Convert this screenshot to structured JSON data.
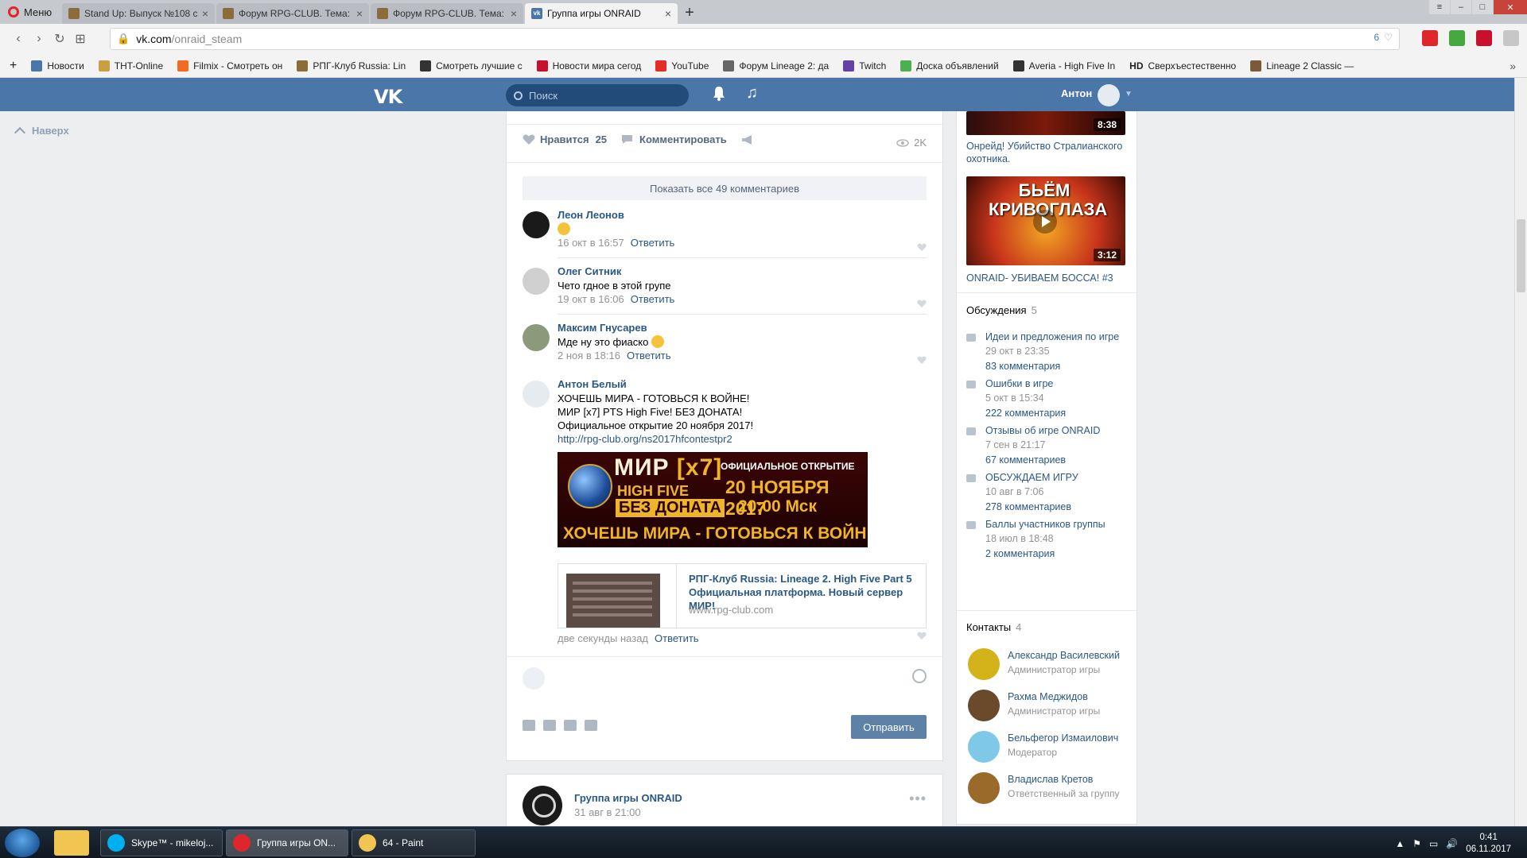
{
  "browser": {
    "menu_label": "Меню",
    "tabs": [
      {
        "title": "Stand Up: Выпуск №108 с",
        "active": false
      },
      {
        "title": "Форум RPG-CLUB. Тема: Ц",
        "active": false
      },
      {
        "title": "Форум RPG-CLUB. Тема: Ц",
        "active": false
      },
      {
        "title": "Группа игры ONRAID",
        "active": true
      }
    ],
    "url_host": "vk.com",
    "url_path": "/onraid_steam",
    "url_badge": "6",
    "bookmarks": [
      {
        "label": "Новости",
        "color": "#4a76a8"
      },
      {
        "label": "THT-Online",
        "color": "#c8a040"
      },
      {
        "label": "Filmix - Смотреть он",
        "color": "#f26b22"
      },
      {
        "label": "РПГ-Клуб Russia: Lin",
        "color": "#8a6d3b"
      },
      {
        "label": "Смотреть лучшие с",
        "color": "#333333"
      },
      {
        "label": "Новости мира сегод",
        "color": "#c8102e"
      },
      {
        "label": "YouTube",
        "color": "#e52d27"
      },
      {
        "label": "Форум Lineage 2: да",
        "color": "#666666"
      },
      {
        "label": "Twitch",
        "color": "#6441a4"
      },
      {
        "label": "Доска объявлений",
        "color": "#4caf50"
      },
      {
        "label": "Averia - High Five In",
        "color": "#333333"
      },
      {
        "label": "Сверхъестественно",
        "color": "#222222"
      },
      {
        "label": "Lineage 2 Classic —",
        "color": "#7a5a3a"
      }
    ],
    "bookmark_hd": "HD"
  },
  "vk": {
    "logo": "VK",
    "search_placeholder": "Поиск",
    "user_name": "Антон",
    "up_link": "Наверх"
  },
  "post": {
    "like_label": "Нравится",
    "like_count": "25",
    "comment_label": "Комментировать",
    "views": "2K",
    "show_all": "Показать все 49 комментариев",
    "comments": [
      {
        "author": "Леон Леонов",
        "text": "",
        "emoji": true,
        "date": "16 окт в 16:57",
        "reply": "Ответить"
      },
      {
        "author": "Олег Ситник",
        "text": "Чето гдное в этой групе",
        "emoji": false,
        "date": "19 окт в 16:06",
        "reply": "Ответить"
      },
      {
        "author": "Максим Гнусарев",
        "text": "Мде ну это фиаско",
        "emoji": true,
        "date": "2 ноя в 18:16",
        "reply": "Ответить"
      }
    ],
    "last_comment": {
      "author": "Антон Белый",
      "lines": [
        "ХОЧЕШЬ МИРА - ГОТОВЬСЯ К ВОЙНЕ!",
        "МИР [x7] PTS High Five! БЕЗ ДОНАТА!",
        "Официальное открытие 20 ноября 2017!"
      ],
      "link": "http://rpg-club.org/ns2017hfcontestpr2",
      "banner": {
        "mir": "МИР",
        "x7": "[x7]",
        "high_five": "HIGH FIVE",
        "no_donate": "БЕЗ ДОНАТА",
        "official": "ОФИЦИАЛЬНОЕ ОТКРЫТИЕ",
        "date": "20 НОЯБРЯ 2017",
        "time": "20:00 Мск",
        "slogan": "ХОЧЕШЬ МИРА - ГОТОВЬСЯ К ВОЙНЕ"
      },
      "card_title": "РПГ-Клуб Russia: Lineage 2. High Five Part 5 Официальная платформа. Новый сервер МИР!",
      "card_domain": "www.rpg-club.com",
      "date": "две секунды назад",
      "reply": "Ответить"
    },
    "send_button": "Отправить"
  },
  "next_post": {
    "group": "Группа игры ONRAID",
    "date": "31 авг в 21:00",
    "more": "•••"
  },
  "sidebar": {
    "videos": [
      {
        "duration": "8:38",
        "title": "Онрейд! Убийство Стралианского охотника."
      },
      {
        "duration": "3:12",
        "title": "ONRAID- УБИВАЕМ БОССА! #3",
        "overlay": "БЬЁМ КРИВОГЛАЗА"
      }
    ],
    "discussions_label": "Обсуждения",
    "discussions_count": "5",
    "topics": [
      {
        "title": "Идеи и предложения по игре",
        "date": "29 окт в 23:35",
        "count": "83 комментария"
      },
      {
        "title": "Ошибки в игре",
        "date": "5 окт в 15:34",
        "count": "222 комментария"
      },
      {
        "title": "Отзывы об игре ONRAID",
        "date": "7 сен в 21:17",
        "count": "67 комментариев"
      },
      {
        "title": "ОБСУЖДАЕМ ИГРУ",
        "date": "10 авг в 7:06",
        "count": "278 комментариев"
      },
      {
        "title": "Баллы участников группы",
        "date": "18 июл в 18:48",
        "count": "2 комментария"
      }
    ],
    "contacts_label": "Контакты",
    "contacts_count": "4",
    "contacts": [
      {
        "name": "Александр Василевский",
        "role": "Администратор игры",
        "color": "#d4b21a"
      },
      {
        "name": "Рахма Меджидов",
        "role": "Администратор игры",
        "color": "#6b4a2b"
      },
      {
        "name": "Бельфегор Измаилович",
        "role": "Модератор",
        "color": "#7fc8e8"
      },
      {
        "name": "Владислав Кретов",
        "role": "Ответственный за группу",
        "color": "#9a6a2a"
      }
    ]
  },
  "taskbar": {
    "apps": [
      {
        "label": "Skype™ - mikeloj...",
        "color": "#00aff0",
        "active": false
      },
      {
        "label": "Группа игры ON...",
        "color": "#e0252c",
        "active": true
      },
      {
        "label": "64 - Paint",
        "color": "#f0c552",
        "active": false
      }
    ],
    "time": "0:41",
    "date": "06.11.2017"
  }
}
